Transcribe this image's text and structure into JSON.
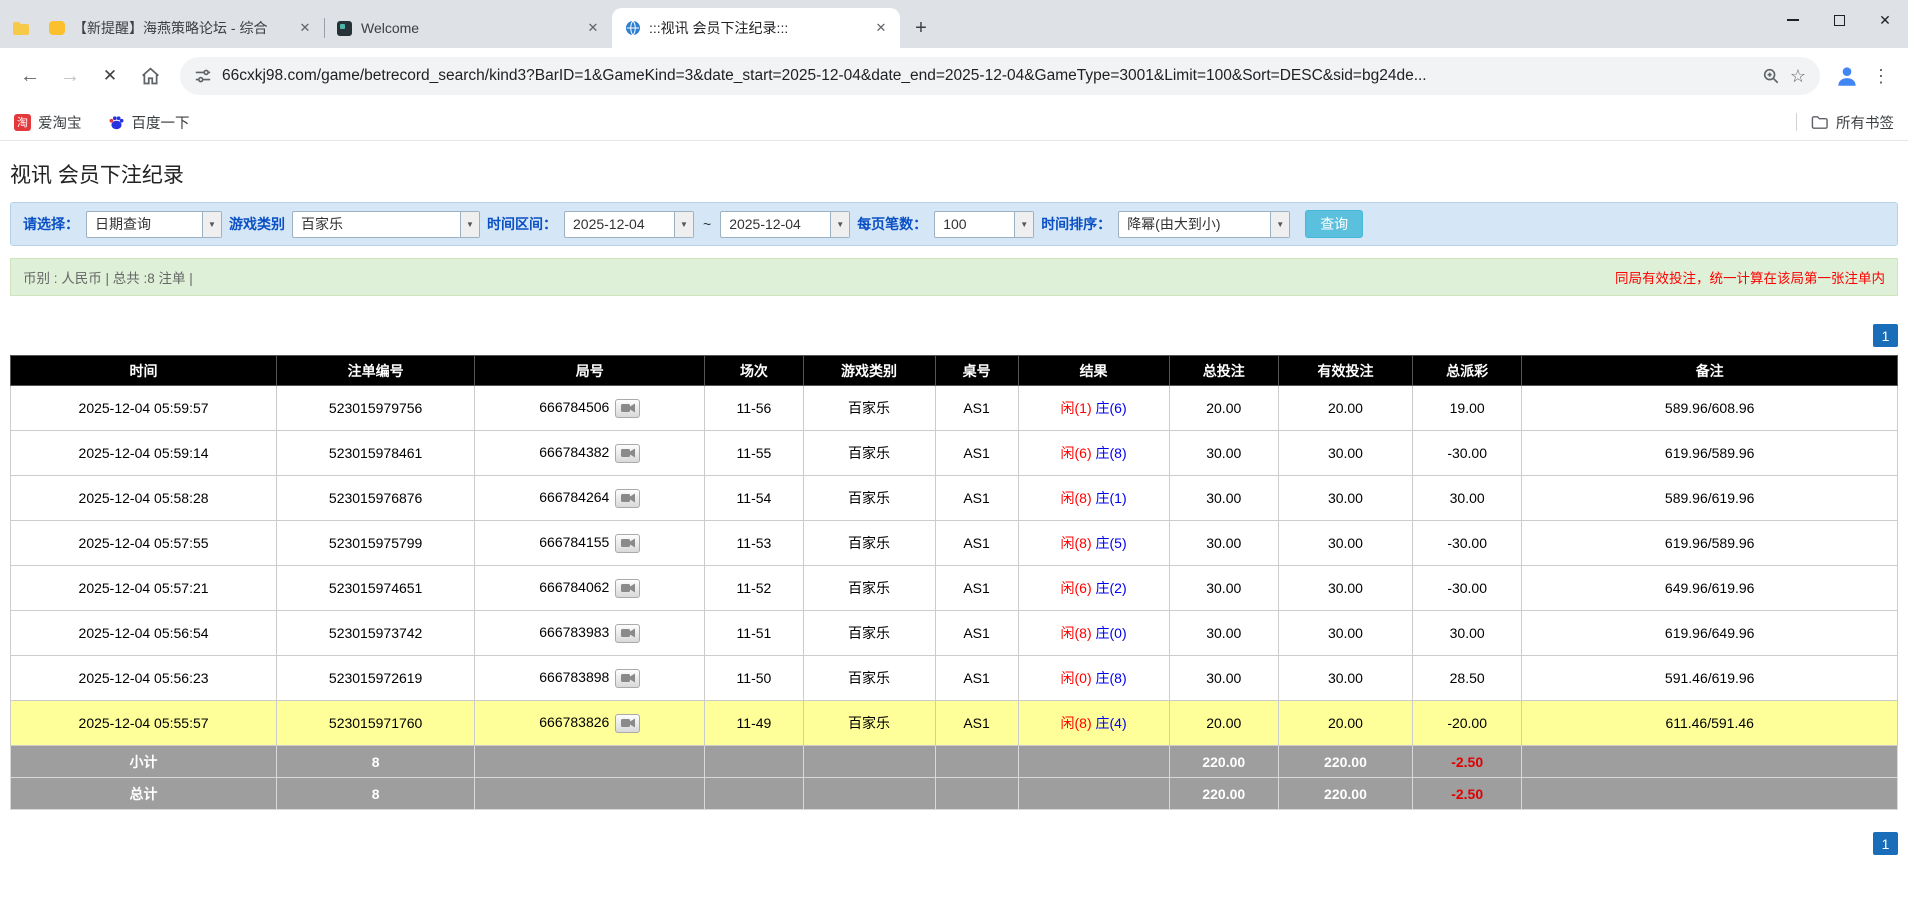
{
  "icons": {
    "back": "←",
    "forward": "→",
    "stop": "✕",
    "menu": "⋮",
    "star": "☆",
    "new_tab": "+",
    "tab_close": "✕",
    "close": "✕",
    "dropdown_arrow": "▼"
  },
  "browser": {
    "tabs": [
      {
        "title": "【新提醒】海燕策略论坛 - 综合",
        "active": false
      },
      {
        "title": "Welcome",
        "active": false
      },
      {
        "title": ":::视讯 会员下注纪录:::",
        "active": true
      }
    ],
    "url": "66cxkj98.com/game/betrecord_search/kind3?BarID=1&GameKind=3&date_start=2025-12-04&date_end=2025-12-04&GameType=3001&Limit=100&Sort=DESC&sid=bg24de...",
    "bookmarks": [
      {
        "label": "爱淘宝"
      },
      {
        "label": "百度一下"
      }
    ],
    "all_bookmarks_label": "所有书签"
  },
  "page": {
    "title": "视讯 会员下注纪录",
    "filters": {
      "select_label": "请选择：",
      "select_value": "日期查询",
      "game_type_label": "游戏类别",
      "game_type_value": "百家乐",
      "date_range_label": "时间区间：",
      "date_start": "2025-12-04",
      "date_separator": "~",
      "date_end": "2025-12-04",
      "page_size_label": "每页笔数：",
      "page_size_value": "100",
      "sort_label": "时间排序：",
      "sort_value": "降幂(由大到小)",
      "search_button": "查询"
    },
    "info_bar": {
      "left": "币别 : 人民币 | 总共 :8 注单 |",
      "right": "同局有效投注，统一计算在该局第一张注单内"
    },
    "pagination": "1",
    "table": {
      "headers": [
        "时间",
        "注单编号",
        "局号",
        "场次",
        "游戏类别",
        "桌号",
        "结果",
        "总投注",
        "有效投注",
        "总派彩",
        "备注"
      ],
      "rows": [
        {
          "time": "2025-12-04 05:59:57",
          "bet_id": "523015979756",
          "round": "666784506",
          "session": "11-56",
          "game": "百家乐",
          "table_no": "AS1",
          "result_player": "闲(1)",
          "result_banker": "庄(6)",
          "total_bet": "20.00",
          "valid_bet": "20.00",
          "payout": "19.00",
          "note": "589.96/608.96",
          "highlight": false
        },
        {
          "time": "2025-12-04 05:59:14",
          "bet_id": "523015978461",
          "round": "666784382",
          "session": "11-55",
          "game": "百家乐",
          "table_no": "AS1",
          "result_player": "闲(6)",
          "result_banker": "庄(8)",
          "total_bet": "30.00",
          "valid_bet": "30.00",
          "payout": "-30.00",
          "note": "619.96/589.96",
          "highlight": false
        },
        {
          "time": "2025-12-04 05:58:28",
          "bet_id": "523015976876",
          "round": "666784264",
          "session": "11-54",
          "game": "百家乐",
          "table_no": "AS1",
          "result_player": "闲(8)",
          "result_banker": "庄(1)",
          "total_bet": "30.00",
          "valid_bet": "30.00",
          "payout": "30.00",
          "note": "589.96/619.96",
          "highlight": false
        },
        {
          "time": "2025-12-04 05:57:55",
          "bet_id": "523015975799",
          "round": "666784155",
          "session": "11-53",
          "game": "百家乐",
          "table_no": "AS1",
          "result_player": "闲(8)",
          "result_banker": "庄(5)",
          "total_bet": "30.00",
          "valid_bet": "30.00",
          "payout": "-30.00",
          "note": "619.96/589.96",
          "highlight": false
        },
        {
          "time": "2025-12-04 05:57:21",
          "bet_id": "523015974651",
          "round": "666784062",
          "session": "11-52",
          "game": "百家乐",
          "table_no": "AS1",
          "result_player": "闲(6)",
          "result_banker": "庄(2)",
          "total_bet": "30.00",
          "valid_bet": "30.00",
          "payout": "-30.00",
          "note": "649.96/619.96",
          "highlight": false
        },
        {
          "time": "2025-12-04 05:56:54",
          "bet_id": "523015973742",
          "round": "666783983",
          "session": "11-51",
          "game": "百家乐",
          "table_no": "AS1",
          "result_player": "闲(8)",
          "result_banker": "庄(0)",
          "total_bet": "30.00",
          "valid_bet": "30.00",
          "payout": "30.00",
          "note": "619.96/649.96",
          "highlight": false
        },
        {
          "time": "2025-12-04 05:56:23",
          "bet_id": "523015972619",
          "round": "666783898",
          "session": "11-50",
          "game": "百家乐",
          "table_no": "AS1",
          "result_player": "闲(0)",
          "result_banker": "庄(8)",
          "total_bet": "30.00",
          "valid_bet": "30.00",
          "payout": "28.50",
          "note": "591.46/619.96",
          "highlight": false
        },
        {
          "time": "2025-12-04 05:55:57",
          "bet_id": "523015971760",
          "round": "666783826",
          "session": "11-49",
          "game": "百家乐",
          "table_no": "AS1",
          "result_player": "闲(8)",
          "result_banker": "庄(4)",
          "total_bet": "20.00",
          "valid_bet": "20.00",
          "payout": "-20.00",
          "note": "611.46/591.46",
          "highlight": true
        }
      ],
      "subtotal": {
        "label": "小计",
        "count": "8",
        "total_bet": "220.00",
        "valid_bet": "220.00",
        "payout": "-2.50"
      },
      "total": {
        "label": "总计",
        "count": "8",
        "total_bet": "220.00",
        "valid_bet": "220.00",
        "payout": "-2.50"
      }
    }
  }
}
